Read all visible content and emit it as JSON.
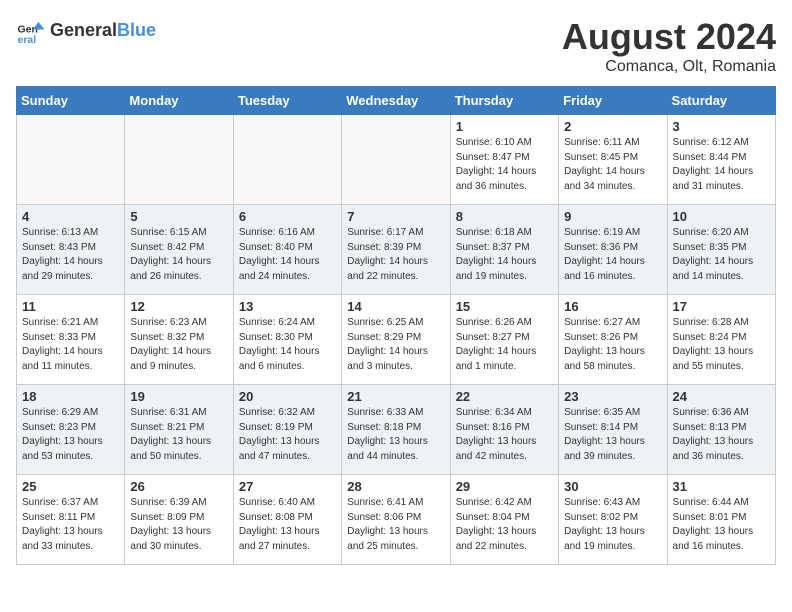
{
  "header": {
    "logo_general": "General",
    "logo_blue": "Blue",
    "month_title": "August 2024",
    "location": "Comanca, Olt, Romania"
  },
  "days_of_week": [
    "Sunday",
    "Monday",
    "Tuesday",
    "Wednesday",
    "Thursday",
    "Friday",
    "Saturday"
  ],
  "weeks": [
    [
      {
        "day": "",
        "info": ""
      },
      {
        "day": "",
        "info": ""
      },
      {
        "day": "",
        "info": ""
      },
      {
        "day": "",
        "info": ""
      },
      {
        "day": "1",
        "info": "Sunrise: 6:10 AM\nSunset: 8:47 PM\nDaylight: 14 hours\nand 36 minutes."
      },
      {
        "day": "2",
        "info": "Sunrise: 6:11 AM\nSunset: 8:45 PM\nDaylight: 14 hours\nand 34 minutes."
      },
      {
        "day": "3",
        "info": "Sunrise: 6:12 AM\nSunset: 8:44 PM\nDaylight: 14 hours\nand 31 minutes."
      }
    ],
    [
      {
        "day": "4",
        "info": "Sunrise: 6:13 AM\nSunset: 8:43 PM\nDaylight: 14 hours\nand 29 minutes."
      },
      {
        "day": "5",
        "info": "Sunrise: 6:15 AM\nSunset: 8:42 PM\nDaylight: 14 hours\nand 26 minutes."
      },
      {
        "day": "6",
        "info": "Sunrise: 6:16 AM\nSunset: 8:40 PM\nDaylight: 14 hours\nand 24 minutes."
      },
      {
        "day": "7",
        "info": "Sunrise: 6:17 AM\nSunset: 8:39 PM\nDaylight: 14 hours\nand 22 minutes."
      },
      {
        "day": "8",
        "info": "Sunrise: 6:18 AM\nSunset: 8:37 PM\nDaylight: 14 hours\nand 19 minutes."
      },
      {
        "day": "9",
        "info": "Sunrise: 6:19 AM\nSunset: 8:36 PM\nDaylight: 14 hours\nand 16 minutes."
      },
      {
        "day": "10",
        "info": "Sunrise: 6:20 AM\nSunset: 8:35 PM\nDaylight: 14 hours\nand 14 minutes."
      }
    ],
    [
      {
        "day": "11",
        "info": "Sunrise: 6:21 AM\nSunset: 8:33 PM\nDaylight: 14 hours\nand 11 minutes."
      },
      {
        "day": "12",
        "info": "Sunrise: 6:23 AM\nSunset: 8:32 PM\nDaylight: 14 hours\nand 9 minutes."
      },
      {
        "day": "13",
        "info": "Sunrise: 6:24 AM\nSunset: 8:30 PM\nDaylight: 14 hours\nand 6 minutes."
      },
      {
        "day": "14",
        "info": "Sunrise: 6:25 AM\nSunset: 8:29 PM\nDaylight: 14 hours\nand 3 minutes."
      },
      {
        "day": "15",
        "info": "Sunrise: 6:26 AM\nSunset: 8:27 PM\nDaylight: 14 hours\nand 1 minute."
      },
      {
        "day": "16",
        "info": "Sunrise: 6:27 AM\nSunset: 8:26 PM\nDaylight: 13 hours\nand 58 minutes."
      },
      {
        "day": "17",
        "info": "Sunrise: 6:28 AM\nSunset: 8:24 PM\nDaylight: 13 hours\nand 55 minutes."
      }
    ],
    [
      {
        "day": "18",
        "info": "Sunrise: 6:29 AM\nSunset: 8:23 PM\nDaylight: 13 hours\nand 53 minutes."
      },
      {
        "day": "19",
        "info": "Sunrise: 6:31 AM\nSunset: 8:21 PM\nDaylight: 13 hours\nand 50 minutes."
      },
      {
        "day": "20",
        "info": "Sunrise: 6:32 AM\nSunset: 8:19 PM\nDaylight: 13 hours\nand 47 minutes."
      },
      {
        "day": "21",
        "info": "Sunrise: 6:33 AM\nSunset: 8:18 PM\nDaylight: 13 hours\nand 44 minutes."
      },
      {
        "day": "22",
        "info": "Sunrise: 6:34 AM\nSunset: 8:16 PM\nDaylight: 13 hours\nand 42 minutes."
      },
      {
        "day": "23",
        "info": "Sunrise: 6:35 AM\nSunset: 8:14 PM\nDaylight: 13 hours\nand 39 minutes."
      },
      {
        "day": "24",
        "info": "Sunrise: 6:36 AM\nSunset: 8:13 PM\nDaylight: 13 hours\nand 36 minutes."
      }
    ],
    [
      {
        "day": "25",
        "info": "Sunrise: 6:37 AM\nSunset: 8:11 PM\nDaylight: 13 hours\nand 33 minutes."
      },
      {
        "day": "26",
        "info": "Sunrise: 6:39 AM\nSunset: 8:09 PM\nDaylight: 13 hours\nand 30 minutes."
      },
      {
        "day": "27",
        "info": "Sunrise: 6:40 AM\nSunset: 8:08 PM\nDaylight: 13 hours\nand 27 minutes."
      },
      {
        "day": "28",
        "info": "Sunrise: 6:41 AM\nSunset: 8:06 PM\nDaylight: 13 hours\nand 25 minutes."
      },
      {
        "day": "29",
        "info": "Sunrise: 6:42 AM\nSunset: 8:04 PM\nDaylight: 13 hours\nand 22 minutes."
      },
      {
        "day": "30",
        "info": "Sunrise: 6:43 AM\nSunset: 8:02 PM\nDaylight: 13 hours\nand 19 minutes."
      },
      {
        "day": "31",
        "info": "Sunrise: 6:44 AM\nSunset: 8:01 PM\nDaylight: 13 hours\nand 16 minutes."
      }
    ]
  ]
}
